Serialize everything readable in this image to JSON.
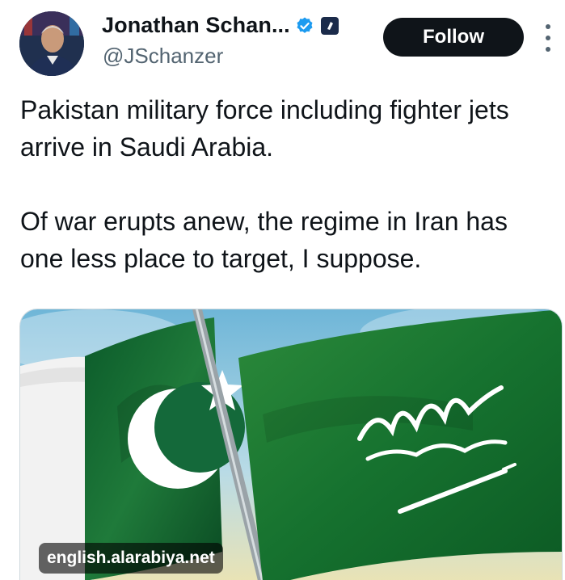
{
  "author": {
    "display_name": "Jonathan Schan...",
    "handle": "@JSchanzer",
    "verified_icon": "verified-badge-icon",
    "affiliation_icon": "affiliate-badge-icon"
  },
  "actions": {
    "follow_label": "Follow",
    "more_icon": "more-options-icon"
  },
  "tweet": {
    "paragraphs": [
      "Pakistan military force including fighter jets arrive in Saudi Arabia.",
      "Of war erupts anew, the regime in Iran has one less place to target, I suppose."
    ]
  },
  "media": {
    "source_label": "english.alarabiya.net"
  },
  "colors": {
    "text": "#0f1419",
    "secondary_text": "#536471",
    "verified_blue": "#1d9bf0",
    "pakistan_green": "#01411c",
    "saudi_green": "#0d7a2f"
  }
}
